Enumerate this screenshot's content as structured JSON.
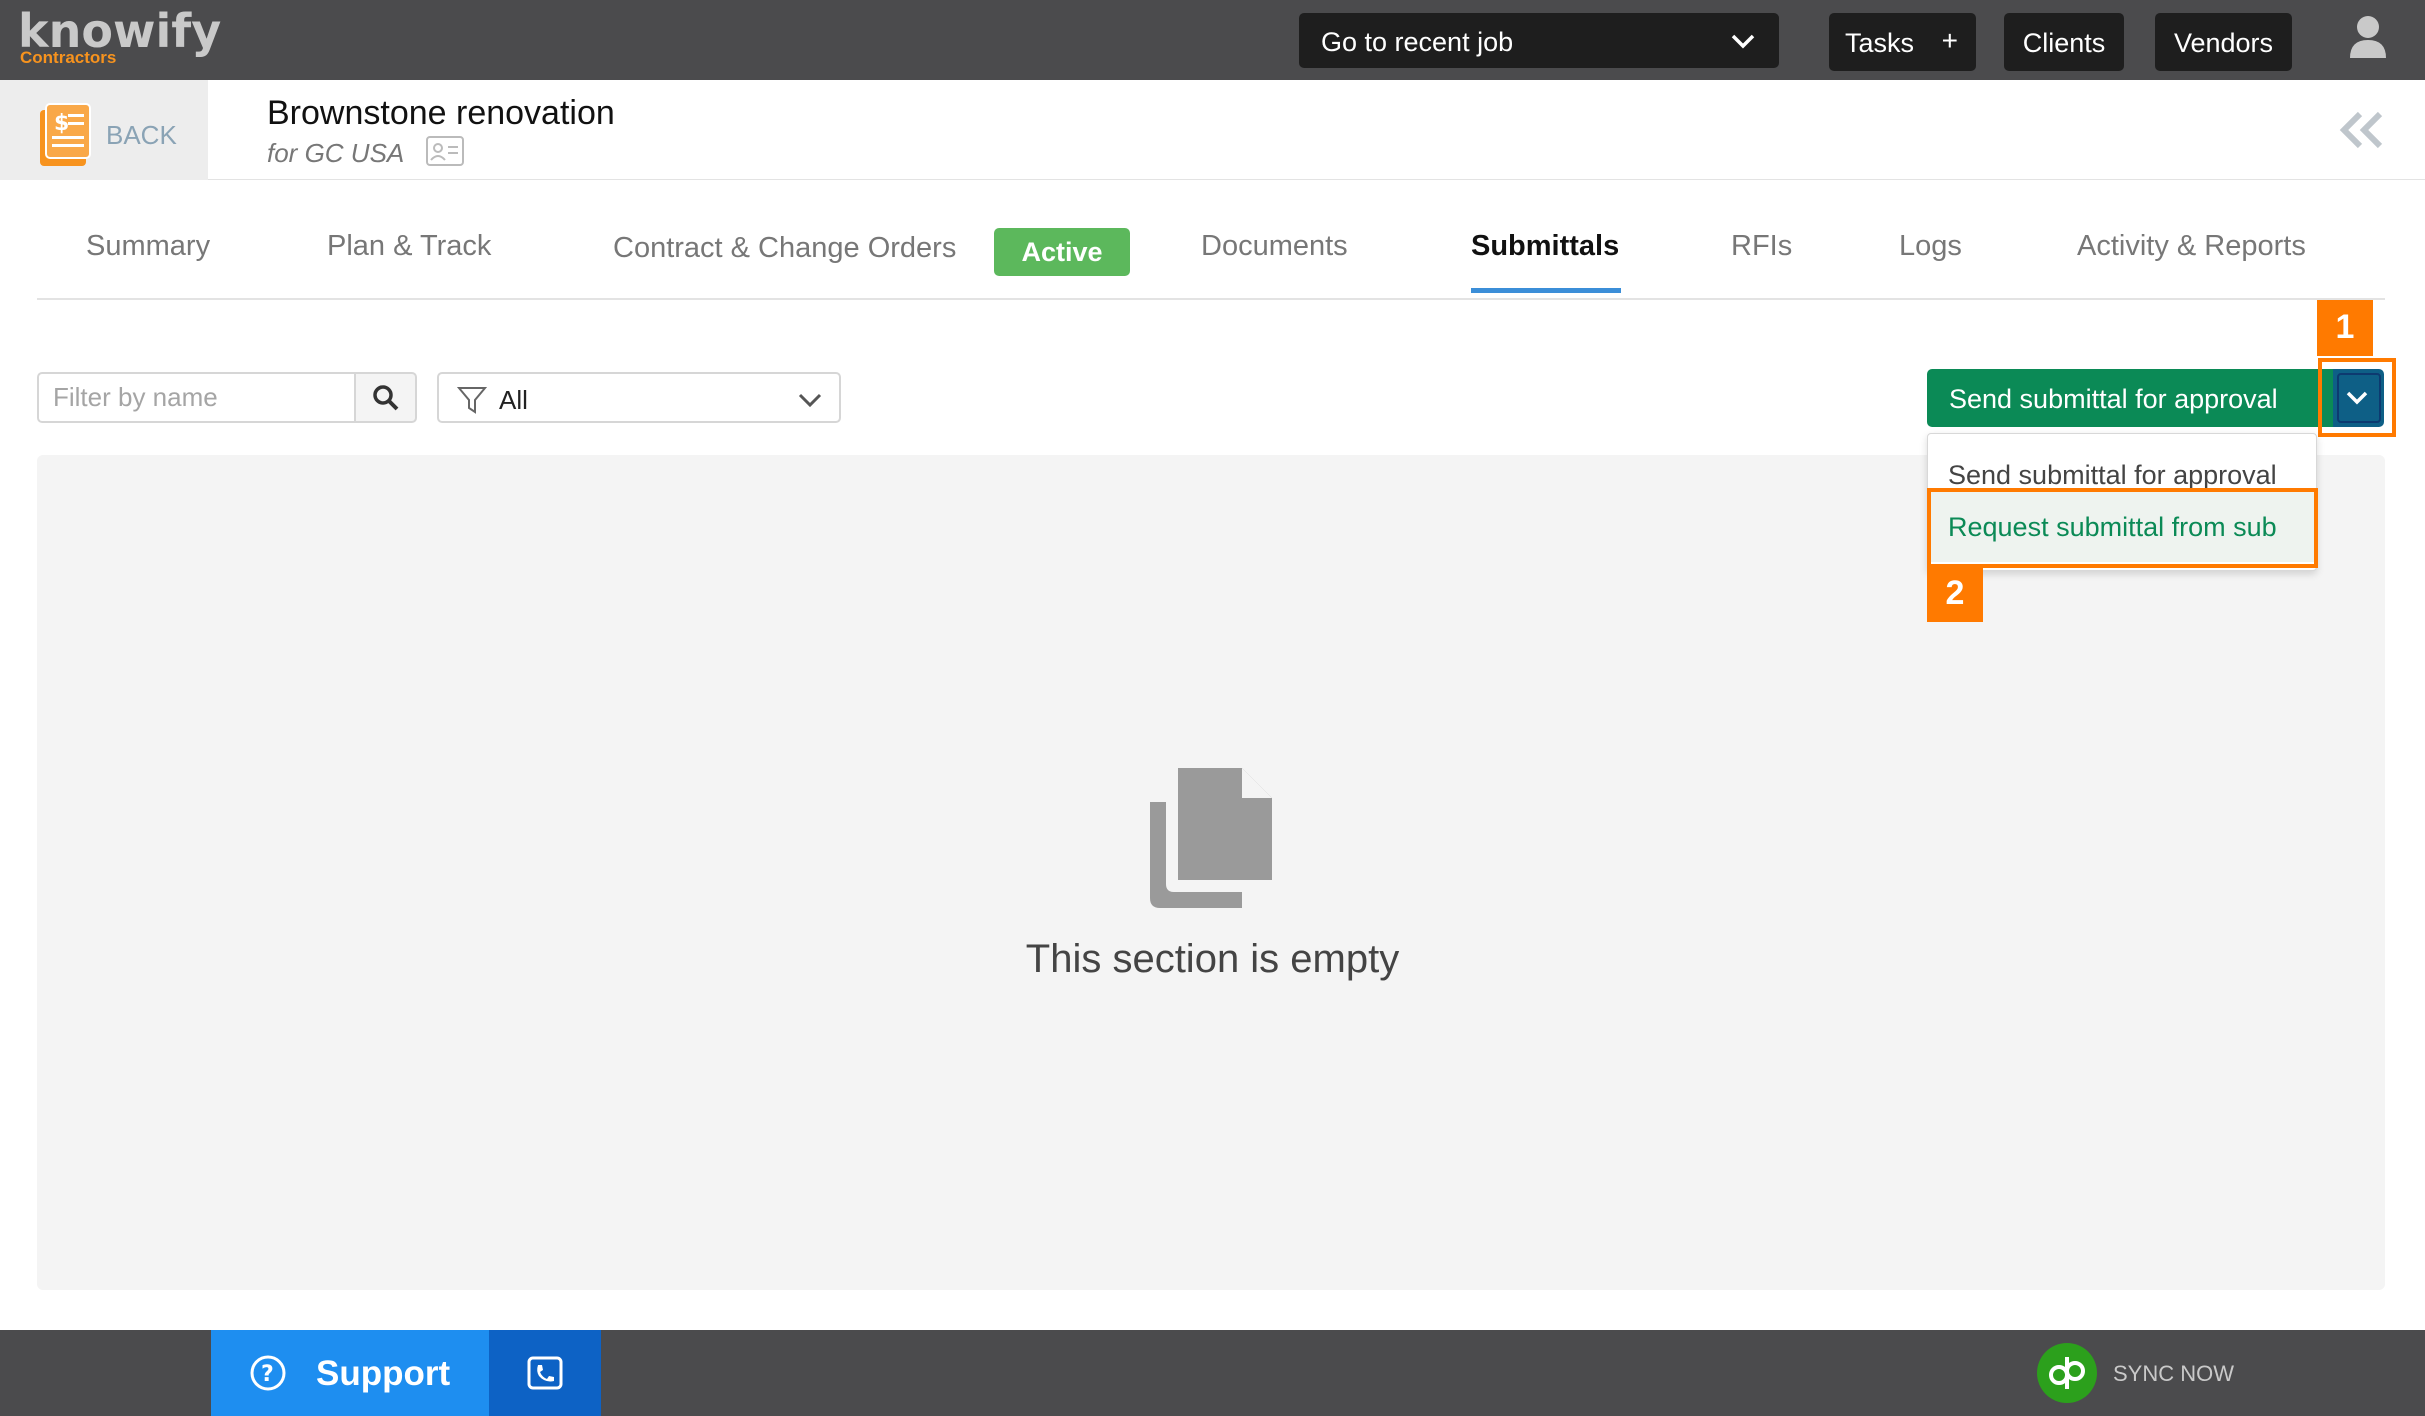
{
  "brand": {
    "name": "knowify",
    "tagline": "Contractors",
    "accent": "#f7931e"
  },
  "topbar": {
    "recent_job": "Go to recent job",
    "tasks": "Tasks",
    "tasks_plus": "+",
    "clients": "Clients",
    "vendors": "Vendors"
  },
  "job": {
    "back_label": "BACK",
    "title": "Brownstone renovation",
    "client": "for GC USA"
  },
  "tabs": [
    {
      "label": "Summary"
    },
    {
      "label": "Plan & Track"
    },
    {
      "label": "Contract & Change Orders",
      "badge": "Active"
    },
    {
      "label": "Documents"
    },
    {
      "label": "Submittals",
      "active": true
    },
    {
      "label": "RFIs"
    },
    {
      "label": "Logs"
    },
    {
      "label": "Activity & Reports"
    }
  ],
  "toolbar": {
    "filter_placeholder": "Filter by name",
    "status_filter": "All",
    "primary_action": "Send submittal for approval"
  },
  "dropdown": {
    "items": [
      "Send submittal for approval",
      "Request submittal from sub"
    ]
  },
  "annotations": {
    "step1": "1",
    "step2": "2",
    "highlight_color": "#ff7a00"
  },
  "empty_state": {
    "text": "This section is empty"
  },
  "footer": {
    "support": "Support",
    "sync": "SYNC NOW"
  }
}
